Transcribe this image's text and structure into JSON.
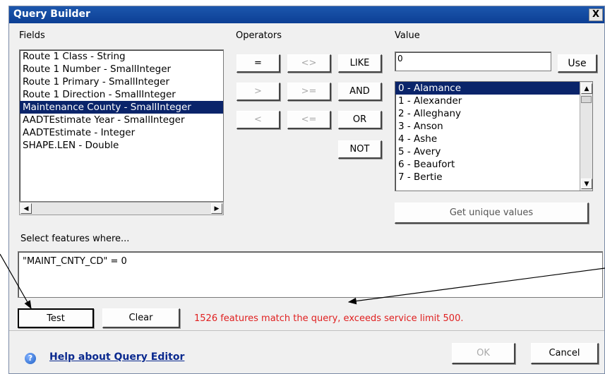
{
  "window": {
    "title": "Query Builder",
    "close_label": "X"
  },
  "fields": {
    "label": "Fields",
    "items": [
      "Route 1 Class - String",
      "Route 1 Number - SmallInteger",
      "Route 1 Primary - SmallInteger",
      "Route 1 Direction - SmallInteger",
      "Maintenance County - SmallInteger",
      "AADTEstimate Year - SmallInteger",
      "AADTEstimate - Integer",
      "SHAPE.LEN - Double"
    ],
    "selected_index": 4
  },
  "operators": {
    "label": "Operators",
    "buttons": [
      "=",
      "<>",
      "LIKE",
      ">",
      ">=",
      "AND",
      "<",
      "<=",
      "OR",
      "NOT"
    ]
  },
  "value": {
    "label": "Value",
    "input_value": "0",
    "use_label": "Use",
    "items": [
      "0 - Alamance",
      "1 - Alexander",
      "2 - Alleghany",
      "3 - Anson",
      "4 - Ashe",
      "5 - Avery",
      "6 - Beaufort",
      "7 - Bertie"
    ],
    "selected_index": 0,
    "unique_label": "Get unique values"
  },
  "where": {
    "label": "Select features where...",
    "expression": "\"MAINT_CNTY_CD\" = 0"
  },
  "actions": {
    "test_label": "Test",
    "clear_label": "Clear",
    "status": "1526 features match the query, exceeds service limit 500."
  },
  "footer": {
    "help_label": "Help about Query Editor",
    "ok_label": "OK",
    "cancel_label": "Cancel"
  },
  "colors": {
    "title_bar": "#0c3f94",
    "selection": "#0a246a",
    "status": "#e02020"
  }
}
